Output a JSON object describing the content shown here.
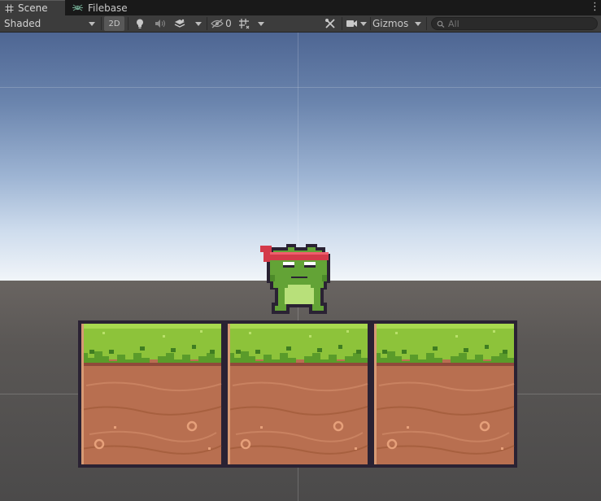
{
  "tabs": [
    {
      "label": "Scene",
      "icon": "grid-icon",
      "active": true
    },
    {
      "label": "Filebase",
      "icon": "spider-icon",
      "active": false
    }
  ],
  "toolbar": {
    "draw_mode": "Shaded",
    "mode_2d": "2D",
    "hidden_count": "0",
    "gizmos_label": "Gizmos",
    "search_placeholder": "All"
  },
  "scene": {
    "sky_top_color": "#4e6693",
    "horizon_color": "#f1f5f9",
    "ground_color": "#5a5755",
    "character": "frog with red headband",
    "tiles": [
      "grass-dirt-tile",
      "grass-dirt-tile",
      "grass-dirt-tile"
    ]
  }
}
